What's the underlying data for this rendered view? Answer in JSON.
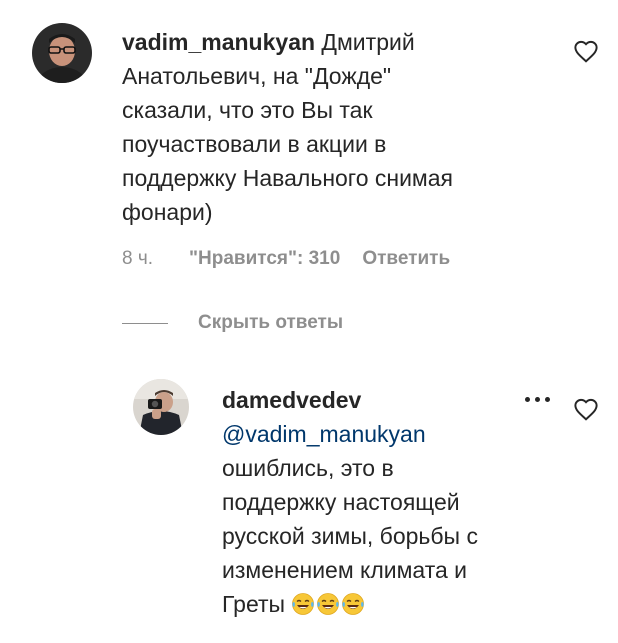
{
  "comment": {
    "username": "vadim_manukyan",
    "lines": [
      "Дмитрий",
      "Анатольевич, на \"Дожде\"",
      "сказали, что это Вы так",
      "поучаствовали в акции в",
      "поддержку Навального снимая",
      "фонари)"
    ],
    "time": "8 ч.",
    "likes": "\"Нравится\": 310",
    "reply_label": "Ответить",
    "avatar_icon": "user-avatar-photo",
    "like_icon": "heart-outline-icon"
  },
  "replies_toggle": {
    "label": "Скрыть ответы"
  },
  "reply": {
    "username": "damedvedev",
    "mention": "@vadim_manukyan",
    "lines": [
      "ошиблись, это в",
      "поддержку настоящей",
      "русской зимы, борьбы с",
      "изменением климата и",
      "Греты"
    ],
    "emoji_icon": "laughing-tears-emoji",
    "emoji_count": 3,
    "more_icon": "more-options-icon",
    "like_icon": "heart-outline-icon"
  },
  "colors": {
    "text": "#262626",
    "secondary": "#8e8e8e",
    "mention": "#00376b"
  }
}
